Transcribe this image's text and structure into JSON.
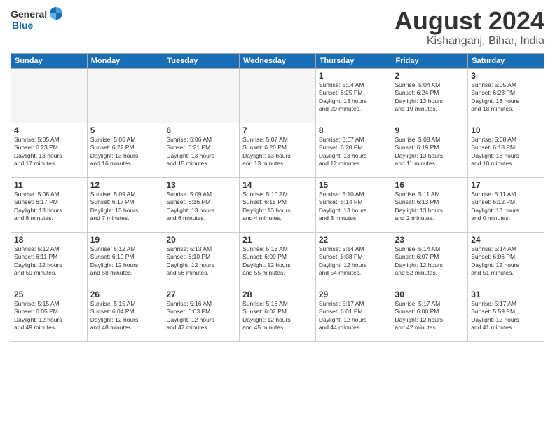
{
  "header": {
    "logo_general": "General",
    "logo_blue": "Blue",
    "main_title": "August 2024",
    "subtitle": "Kishanganj, Bihar, India"
  },
  "weekdays": [
    "Sunday",
    "Monday",
    "Tuesday",
    "Wednesday",
    "Thursday",
    "Friday",
    "Saturday"
  ],
  "weeks": [
    [
      {
        "day": "",
        "empty": true
      },
      {
        "day": "",
        "empty": true
      },
      {
        "day": "",
        "empty": true
      },
      {
        "day": "",
        "empty": true
      },
      {
        "day": "1",
        "info": "Sunrise: 5:04 AM\nSunset: 6:25 PM\nDaylight: 13 hours\nand 20 minutes."
      },
      {
        "day": "2",
        "info": "Sunrise: 5:04 AM\nSunset: 6:24 PM\nDaylight: 13 hours\nand 19 minutes."
      },
      {
        "day": "3",
        "info": "Sunrise: 5:05 AM\nSunset: 6:23 PM\nDaylight: 13 hours\nand 18 minutes."
      }
    ],
    [
      {
        "day": "4",
        "info": "Sunrise: 5:05 AM\nSunset: 6:23 PM\nDaylight: 13 hours\nand 17 minutes."
      },
      {
        "day": "5",
        "info": "Sunrise: 5:06 AM\nSunset: 6:22 PM\nDaylight: 13 hours\nand 16 minutes."
      },
      {
        "day": "6",
        "info": "Sunrise: 5:06 AM\nSunset: 6:21 PM\nDaylight: 13 hours\nand 15 minutes."
      },
      {
        "day": "7",
        "info": "Sunrise: 5:07 AM\nSunset: 6:20 PM\nDaylight: 13 hours\nand 13 minutes."
      },
      {
        "day": "8",
        "info": "Sunrise: 5:07 AM\nSunset: 6:20 PM\nDaylight: 13 hours\nand 12 minutes."
      },
      {
        "day": "9",
        "info": "Sunrise: 5:08 AM\nSunset: 6:19 PM\nDaylight: 13 hours\nand 11 minutes."
      },
      {
        "day": "10",
        "info": "Sunrise: 5:08 AM\nSunset: 6:18 PM\nDaylight: 13 hours\nand 10 minutes."
      }
    ],
    [
      {
        "day": "11",
        "info": "Sunrise: 5:08 AM\nSunset: 6:17 PM\nDaylight: 13 hours\nand 8 minutes."
      },
      {
        "day": "12",
        "info": "Sunrise: 5:09 AM\nSunset: 6:17 PM\nDaylight: 13 hours\nand 7 minutes."
      },
      {
        "day": "13",
        "info": "Sunrise: 5:09 AM\nSunset: 6:16 PM\nDaylight: 13 hours\nand 6 minutes."
      },
      {
        "day": "14",
        "info": "Sunrise: 5:10 AM\nSunset: 6:15 PM\nDaylight: 13 hours\nand 4 minutes."
      },
      {
        "day": "15",
        "info": "Sunrise: 5:10 AM\nSunset: 6:14 PM\nDaylight: 13 hours\nand 3 minutes."
      },
      {
        "day": "16",
        "info": "Sunrise: 5:11 AM\nSunset: 6:13 PM\nDaylight: 13 hours\nand 2 minutes."
      },
      {
        "day": "17",
        "info": "Sunrise: 5:11 AM\nSunset: 6:12 PM\nDaylight: 13 hours\nand 0 minutes."
      }
    ],
    [
      {
        "day": "18",
        "info": "Sunrise: 5:12 AM\nSunset: 6:11 PM\nDaylight: 12 hours\nand 59 minutes."
      },
      {
        "day": "19",
        "info": "Sunrise: 5:12 AM\nSunset: 6:10 PM\nDaylight: 12 hours\nand 58 minutes."
      },
      {
        "day": "20",
        "info": "Sunrise: 5:13 AM\nSunset: 6:10 PM\nDaylight: 12 hours\nand 56 minutes."
      },
      {
        "day": "21",
        "info": "Sunrise: 5:13 AM\nSunset: 6:09 PM\nDaylight: 12 hours\nand 55 minutes."
      },
      {
        "day": "22",
        "info": "Sunrise: 5:14 AM\nSunset: 6:08 PM\nDaylight: 12 hours\nand 54 minutes."
      },
      {
        "day": "23",
        "info": "Sunrise: 5:14 AM\nSunset: 6:07 PM\nDaylight: 12 hours\nand 52 minutes."
      },
      {
        "day": "24",
        "info": "Sunrise: 5:14 AM\nSunset: 6:06 PM\nDaylight: 12 hours\nand 51 minutes."
      }
    ],
    [
      {
        "day": "25",
        "info": "Sunrise: 5:15 AM\nSunset: 6:05 PM\nDaylight: 12 hours\nand 49 minutes."
      },
      {
        "day": "26",
        "info": "Sunrise: 5:15 AM\nSunset: 6:04 PM\nDaylight: 12 hours\nand 48 minutes."
      },
      {
        "day": "27",
        "info": "Sunrise: 5:16 AM\nSunset: 6:03 PM\nDaylight: 12 hours\nand 47 minutes."
      },
      {
        "day": "28",
        "info": "Sunrise: 5:16 AM\nSunset: 6:02 PM\nDaylight: 12 hours\nand 45 minutes."
      },
      {
        "day": "29",
        "info": "Sunrise: 5:17 AM\nSunset: 6:01 PM\nDaylight: 12 hours\nand 44 minutes."
      },
      {
        "day": "30",
        "info": "Sunrise: 5:17 AM\nSunset: 6:00 PM\nDaylight: 12 hours\nand 42 minutes."
      },
      {
        "day": "31",
        "info": "Sunrise: 5:17 AM\nSunset: 5:59 PM\nDaylight: 12 hours\nand 41 minutes."
      }
    ]
  ]
}
